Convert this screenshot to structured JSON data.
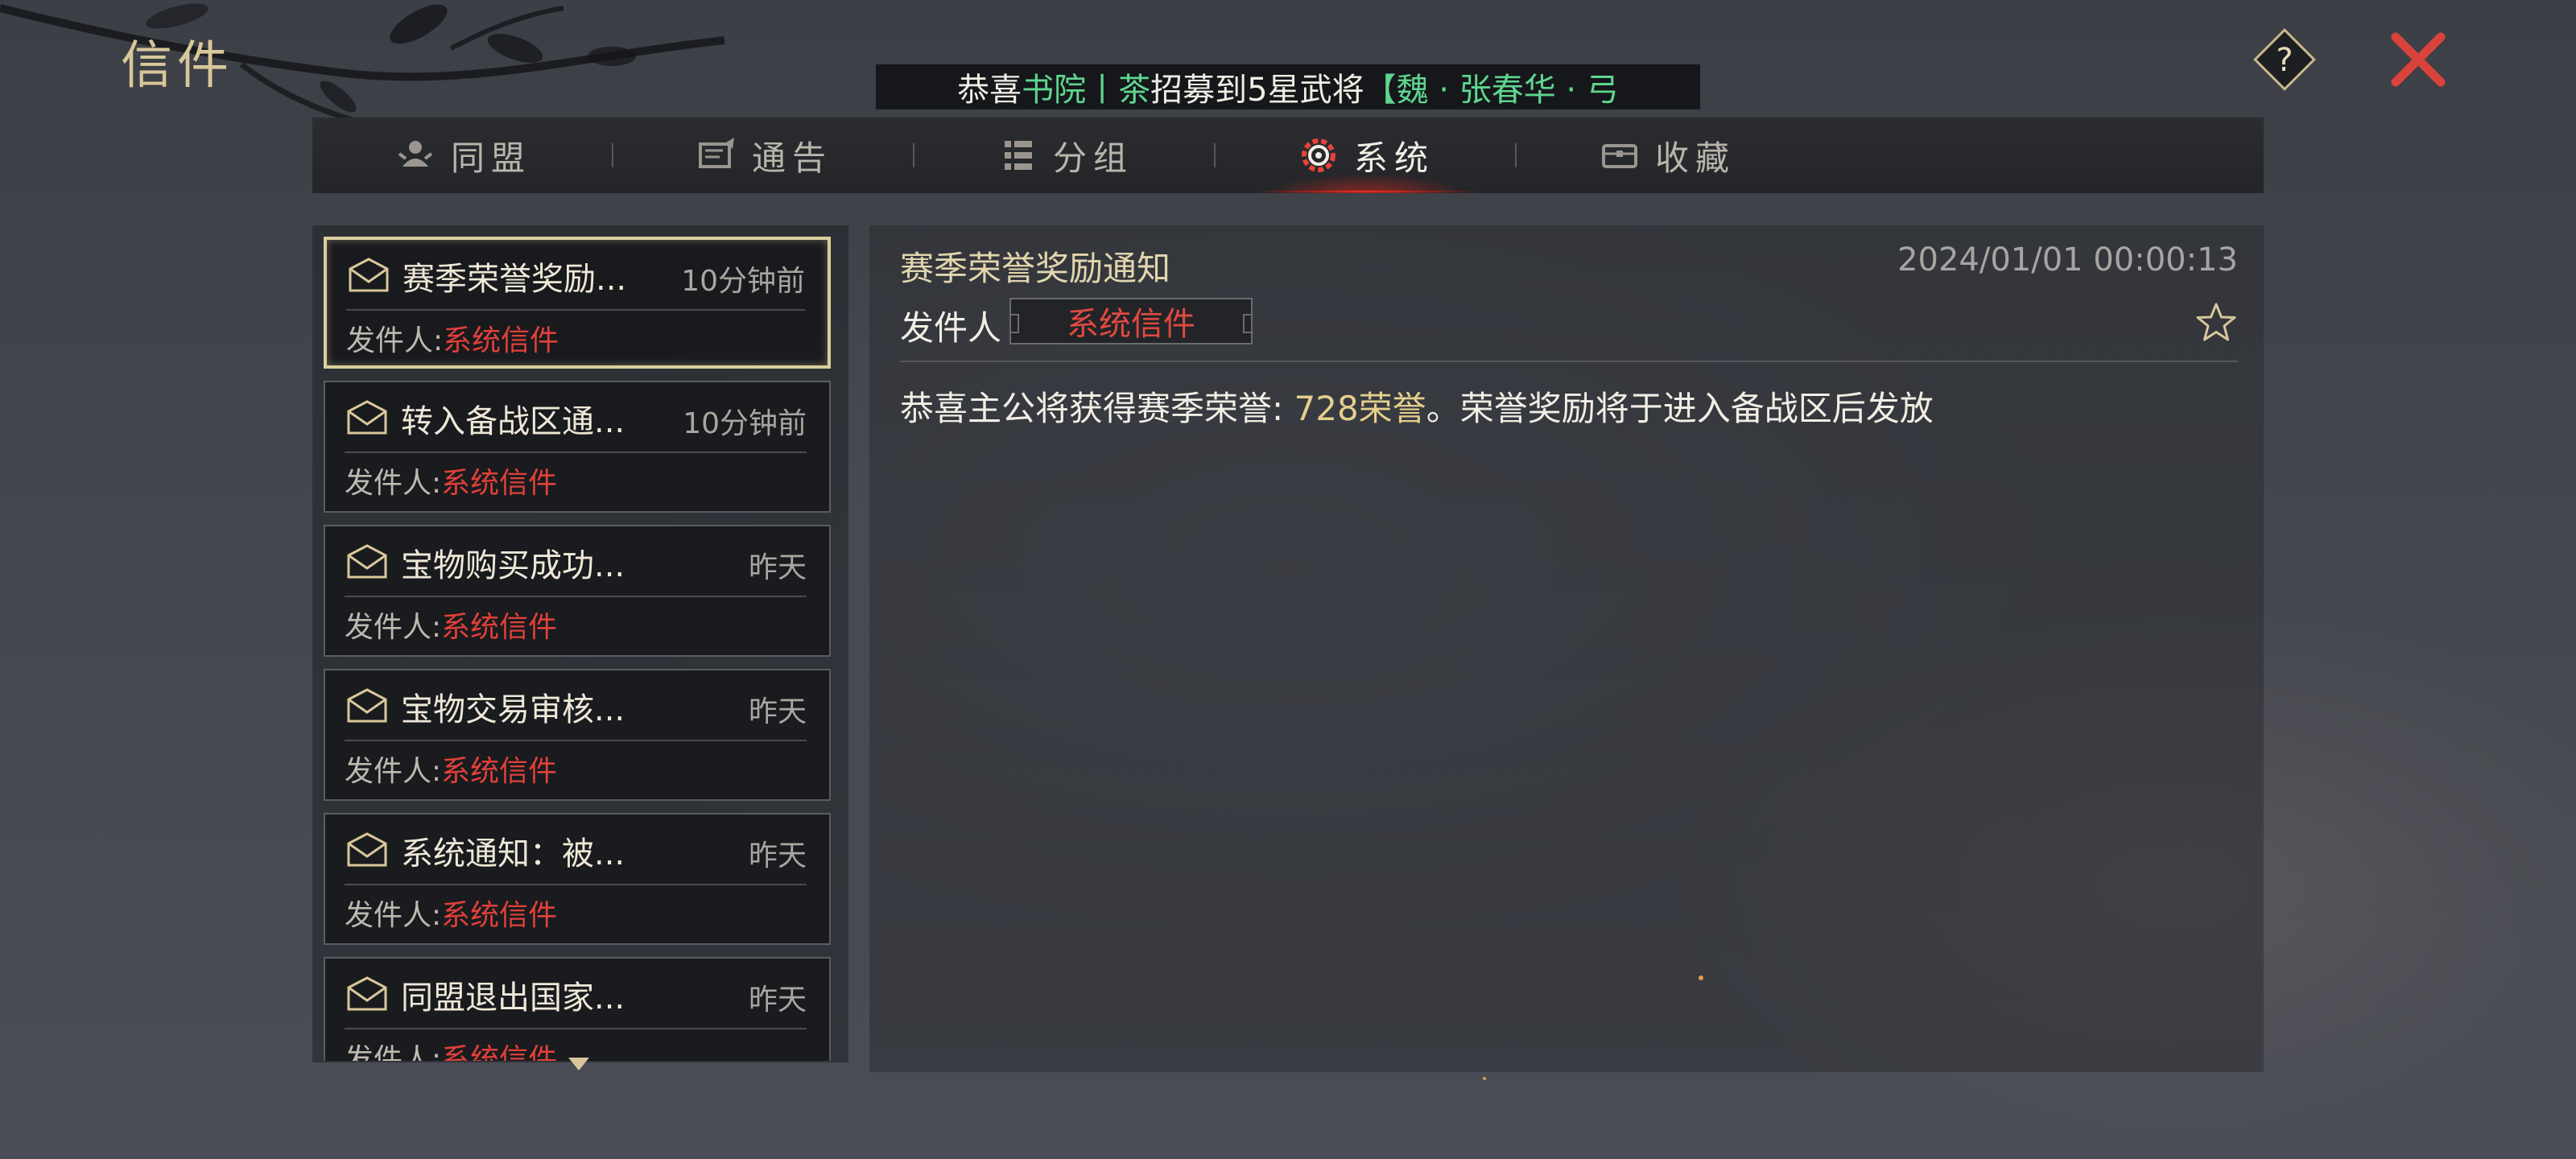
{
  "header": {
    "title": "信件"
  },
  "banner": {
    "prefix": "恭喜",
    "player": "书院丨茶",
    "middle": "招募到5星武将",
    "hero": "【魏 · 张春华 · 弓"
  },
  "tabs": [
    {
      "label": "同盟",
      "icon": "alliance-icon"
    },
    {
      "label": "通告",
      "icon": "announcement-icon"
    },
    {
      "label": "分组",
      "icon": "group-icon"
    },
    {
      "label": "系统",
      "icon": "system-gear-icon",
      "active": true
    },
    {
      "label": "收藏",
      "icon": "favorites-chest-icon"
    }
  ],
  "mails": [
    {
      "subject": "赛季荣誉奖励...",
      "time": "10分钟前",
      "sender_label": "发件人:",
      "sender": "系统信件",
      "selected": true
    },
    {
      "subject": "转入备战区通...",
      "time": "10分钟前",
      "sender_label": "发件人:",
      "sender": "系统信件"
    },
    {
      "subject": "宝物购买成功...",
      "time": "昨天",
      "sender_label": "发件人:",
      "sender": "系统信件"
    },
    {
      "subject": "宝物交易审核...",
      "time": "昨天",
      "sender_label": "发件人:",
      "sender": "系统信件"
    },
    {
      "subject": "系统通知：被...",
      "time": "昨天",
      "sender_label": "发件人:",
      "sender": "系统信件"
    },
    {
      "subject": "同盟退出国家...",
      "time": "昨天",
      "sender_label": "发件人:",
      "sender": "系统信件"
    }
  ],
  "detail": {
    "title": "赛季荣誉奖励通知",
    "date": "2024/01/01 00:00:13",
    "sender_label": "发件人",
    "sender": "系统信件",
    "body_prefix": "恭喜主公将获得赛季荣誉: ",
    "body_highlight": "728荣誉",
    "body_suffix": "。荣誉奖励将于进入备战区后发放"
  },
  "colors": {
    "accent_gold": "#d8c79a",
    "sender_red": "#e0403a",
    "banner_green": "#5fd68f",
    "close_red": "#d9433b"
  }
}
